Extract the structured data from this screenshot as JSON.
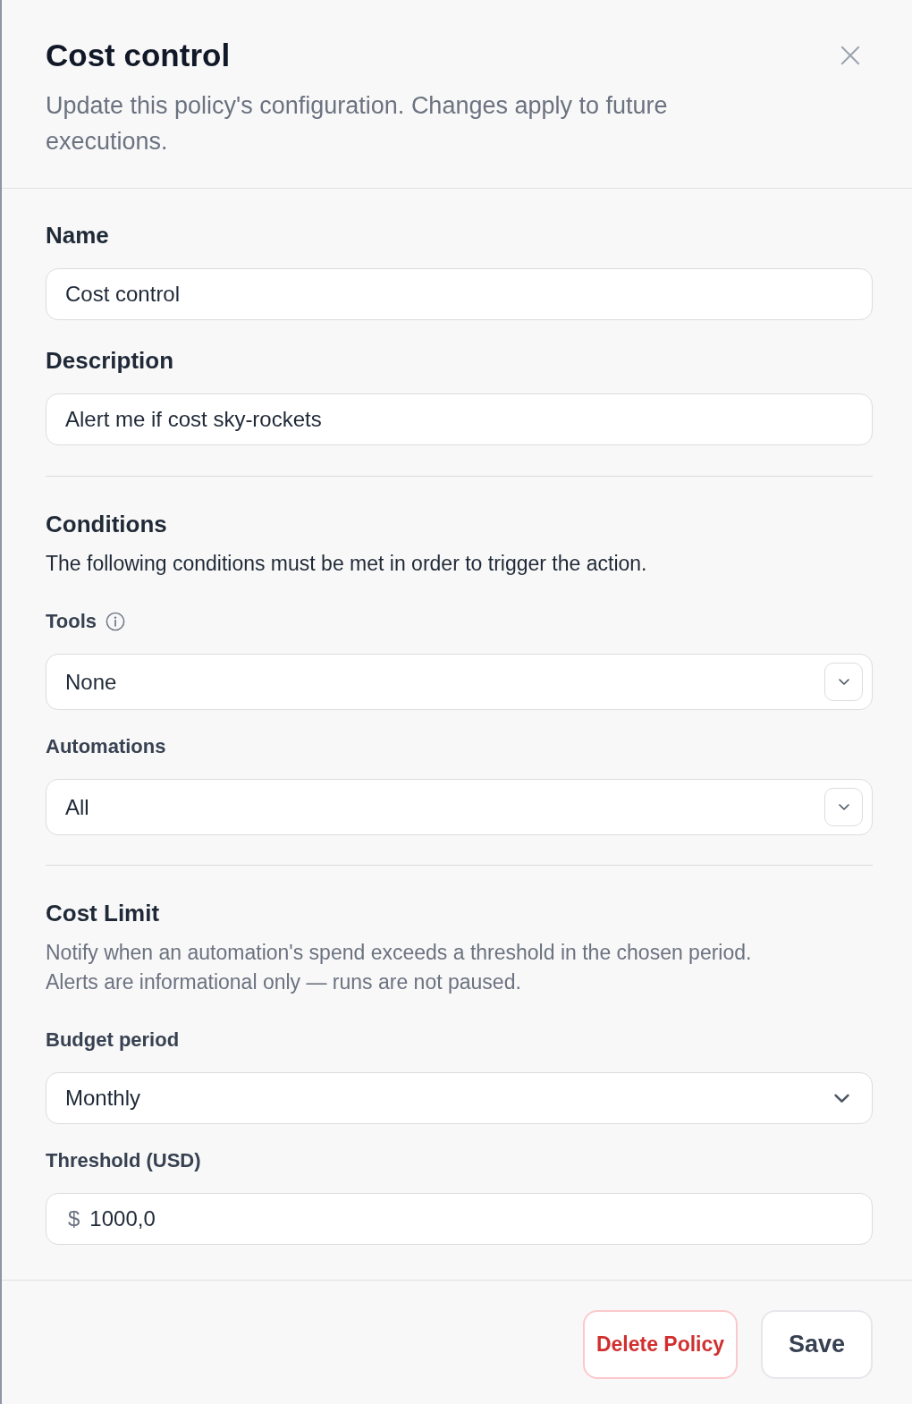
{
  "dialog": {
    "title": "Cost control",
    "subtitle": "Update this policy's configuration. Changes apply to future executions."
  },
  "fields": [
    {
      "kind": "text",
      "label": "Name",
      "value": "Cost control"
    },
    {
      "kind": "text",
      "label": "Description",
      "value": "Alert me if cost sky-rockets"
    }
  ],
  "sections": [
    {
      "title": "Conditions",
      "description": "The following conditions must be met in order to trigger the action.",
      "muted": false,
      "fields": [
        {
          "kind": "multiselect",
          "label": "Tools",
          "info": true,
          "value": "None"
        },
        {
          "kind": "multiselect",
          "label": "Automations",
          "info": false,
          "value": "All"
        }
      ]
    },
    {
      "title": "Cost Limit",
      "description": "Notify when an automation's spend exceeds a threshold in the chosen period. Alerts are informational only — runs are not paused.",
      "muted": true,
      "fields": [
        {
          "kind": "select",
          "label": "Budget period",
          "info": false,
          "value": "Monthly"
        },
        {
          "kind": "currency",
          "label": "Threshold (USD)",
          "info": false,
          "prefix": "$",
          "value": "1000,0"
        }
      ]
    }
  ],
  "footer": {
    "buttons": [
      {
        "kind": "danger",
        "label": "Delete Policy"
      },
      {
        "kind": "default",
        "label": "Save"
      }
    ]
  }
}
